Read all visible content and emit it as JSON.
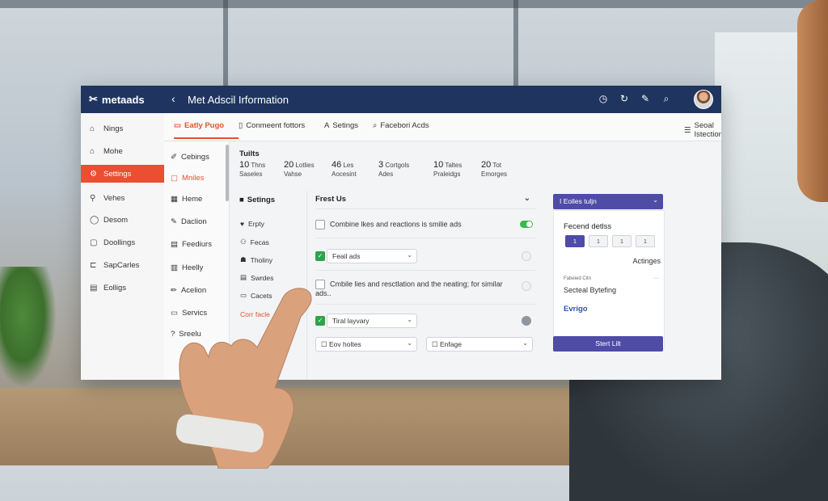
{
  "app": {
    "logo": "metaads",
    "title": "Met Adscil Irformation"
  },
  "topbar": {
    "icons": [
      "clock-icon",
      "history-icon",
      "edit-icon",
      "search-icon"
    ]
  },
  "sidebar": {
    "items": [
      {
        "label": "Nings",
        "icon": "home-icon",
        "active": false
      },
      {
        "label": "Mohe",
        "icon": "home-alt-icon",
        "active": false
      },
      {
        "label": "Settings",
        "icon": "settings-icon",
        "active": true
      },
      {
        "label": "Vehes",
        "icon": "user-icon",
        "active": false
      },
      {
        "label": "Desom",
        "icon": "chat-icon",
        "active": false
      },
      {
        "label": "Doollings",
        "icon": "document-icon",
        "active": false
      },
      {
        "label": "SapCarles",
        "icon": "tag-icon",
        "active": false
      },
      {
        "label": "Eolligs",
        "icon": "file-icon",
        "active": false
      }
    ]
  },
  "tabs": [
    {
      "label": "Eatly Pugo",
      "icon": "folder-icon",
      "active": true
    },
    {
      "label": "Conmeent fottors",
      "icon": "page-icon",
      "active": false
    },
    {
      "label": "Setings",
      "prefix": "A",
      "active": false
    },
    {
      "label": "Facebori Acds",
      "icon": "search-icon",
      "active": false
    },
    {
      "label": "Seoal Istections",
      "icon": "list-icon",
      "active": false
    }
  ],
  "sub_nav": [
    {
      "label": "Cebings",
      "icon": "pen-icon",
      "active": false
    },
    {
      "label": "Mniles",
      "icon": "square-icon",
      "active": true
    },
    {
      "label": "Heme",
      "icon": "grid-icon",
      "active": false
    },
    {
      "label": "Daclion",
      "icon": "edit-icon",
      "active": false
    },
    {
      "label": "Feediurs",
      "icon": "feed-icon",
      "active": false
    },
    {
      "label": "Heelly",
      "icon": "book-icon",
      "active": false
    },
    {
      "label": "Acelion",
      "icon": "pencil-icon",
      "active": false
    },
    {
      "label": "Servics",
      "icon": "service-icon",
      "active": false
    },
    {
      "label": "Sreelu",
      "icon": "help-icon",
      "active": false
    }
  ],
  "stats": {
    "title": "Tuilts",
    "items": [
      {
        "value": "10",
        "unit": "Thns",
        "label": "Saseles"
      },
      {
        "value": "20",
        "unit": "Lotlies",
        "label": "Vahse"
      },
      {
        "value": "46",
        "unit": "Les",
        "label": "Aocesint"
      },
      {
        "value": "3",
        "unit": "Cortgols",
        "label": "Ades"
      },
      {
        "value": "10",
        "unit": "Taltes",
        "label": "Praleidgs"
      },
      {
        "value": "20",
        "unit": "Tot",
        "label": "Emorges"
      }
    ]
  },
  "settings_col": {
    "title": "Setings",
    "items": [
      {
        "label": "Erpty",
        "icon": "heart-icon"
      },
      {
        "label": "Fecas",
        "icon": "users-icon"
      },
      {
        "label": "Tholiny",
        "icon": "person-icon"
      },
      {
        "label": "Swrdes",
        "icon": "doc-icon"
      },
      {
        "label": "Cacets",
        "icon": "card-icon"
      }
    ],
    "link": "Corr facle"
  },
  "main_panel": {
    "title": "Frest Us",
    "row1": "Combine lkes and reactions is smilie ads",
    "select1": "Feail ads",
    "row3": "Cmbile lies and resctlation and the neating; for similar ads..",
    "select2": "Tiral layvary",
    "select3": "Eov holtes",
    "select4": "Enfage"
  },
  "right_panel": {
    "dropdown": "I Eolles tuljn",
    "card_title": "Fecend detlss",
    "pages": [
      "1",
      "1",
      "1",
      "1"
    ],
    "action": "Actinges",
    "small_label": "Fabeied Citn",
    "label": "Secteal Bytefing",
    "link": "Evrigo",
    "button": "Stert Lilt"
  },
  "colors": {
    "topbar": "#1f3560",
    "accent": "#e94f30",
    "primary": "#4f4ca8",
    "toggle_on": "#3ab84c"
  }
}
